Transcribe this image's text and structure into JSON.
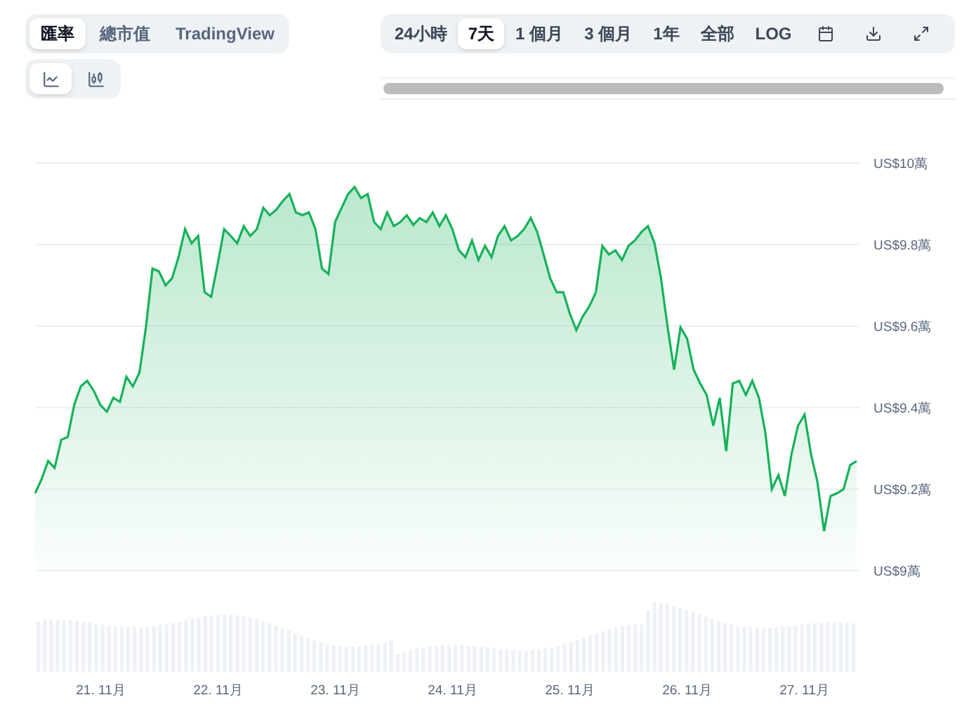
{
  "view_tabs": [
    {
      "label": "匯率",
      "selected": true
    },
    {
      "label": "總市值",
      "selected": false
    },
    {
      "label": "TradingView",
      "selected": false
    }
  ],
  "chart_types": [
    {
      "kind": "line",
      "selected": true
    },
    {
      "kind": "bars",
      "selected": false
    }
  ],
  "ranges": [
    {
      "label": "24小時",
      "selected": false
    },
    {
      "label": "7天",
      "selected": true
    },
    {
      "label": "1 個月",
      "selected": false
    },
    {
      "label": "3 個月",
      "selected": false
    },
    {
      "label": "1年",
      "selected": false
    },
    {
      "label": "全部",
      "selected": false
    },
    {
      "label": "LOG",
      "selected": false
    }
  ],
  "tools": [
    {
      "kind": "calendar"
    },
    {
      "kind": "download"
    },
    {
      "kind": "expand"
    }
  ],
  "chart": {
    "y_axis_labels": [
      "US$10萬",
      "US$9.8萬",
      "US$9.6萬",
      "US$9.4萬",
      "US$9.2萬",
      "US$9萬"
    ],
    "x_axis_labels": [
      "21. 11月",
      "22. 11月",
      "23. 11月",
      "24. 11月",
      "25. 11月",
      "26. 11月",
      "27. 11月"
    ]
  }
}
